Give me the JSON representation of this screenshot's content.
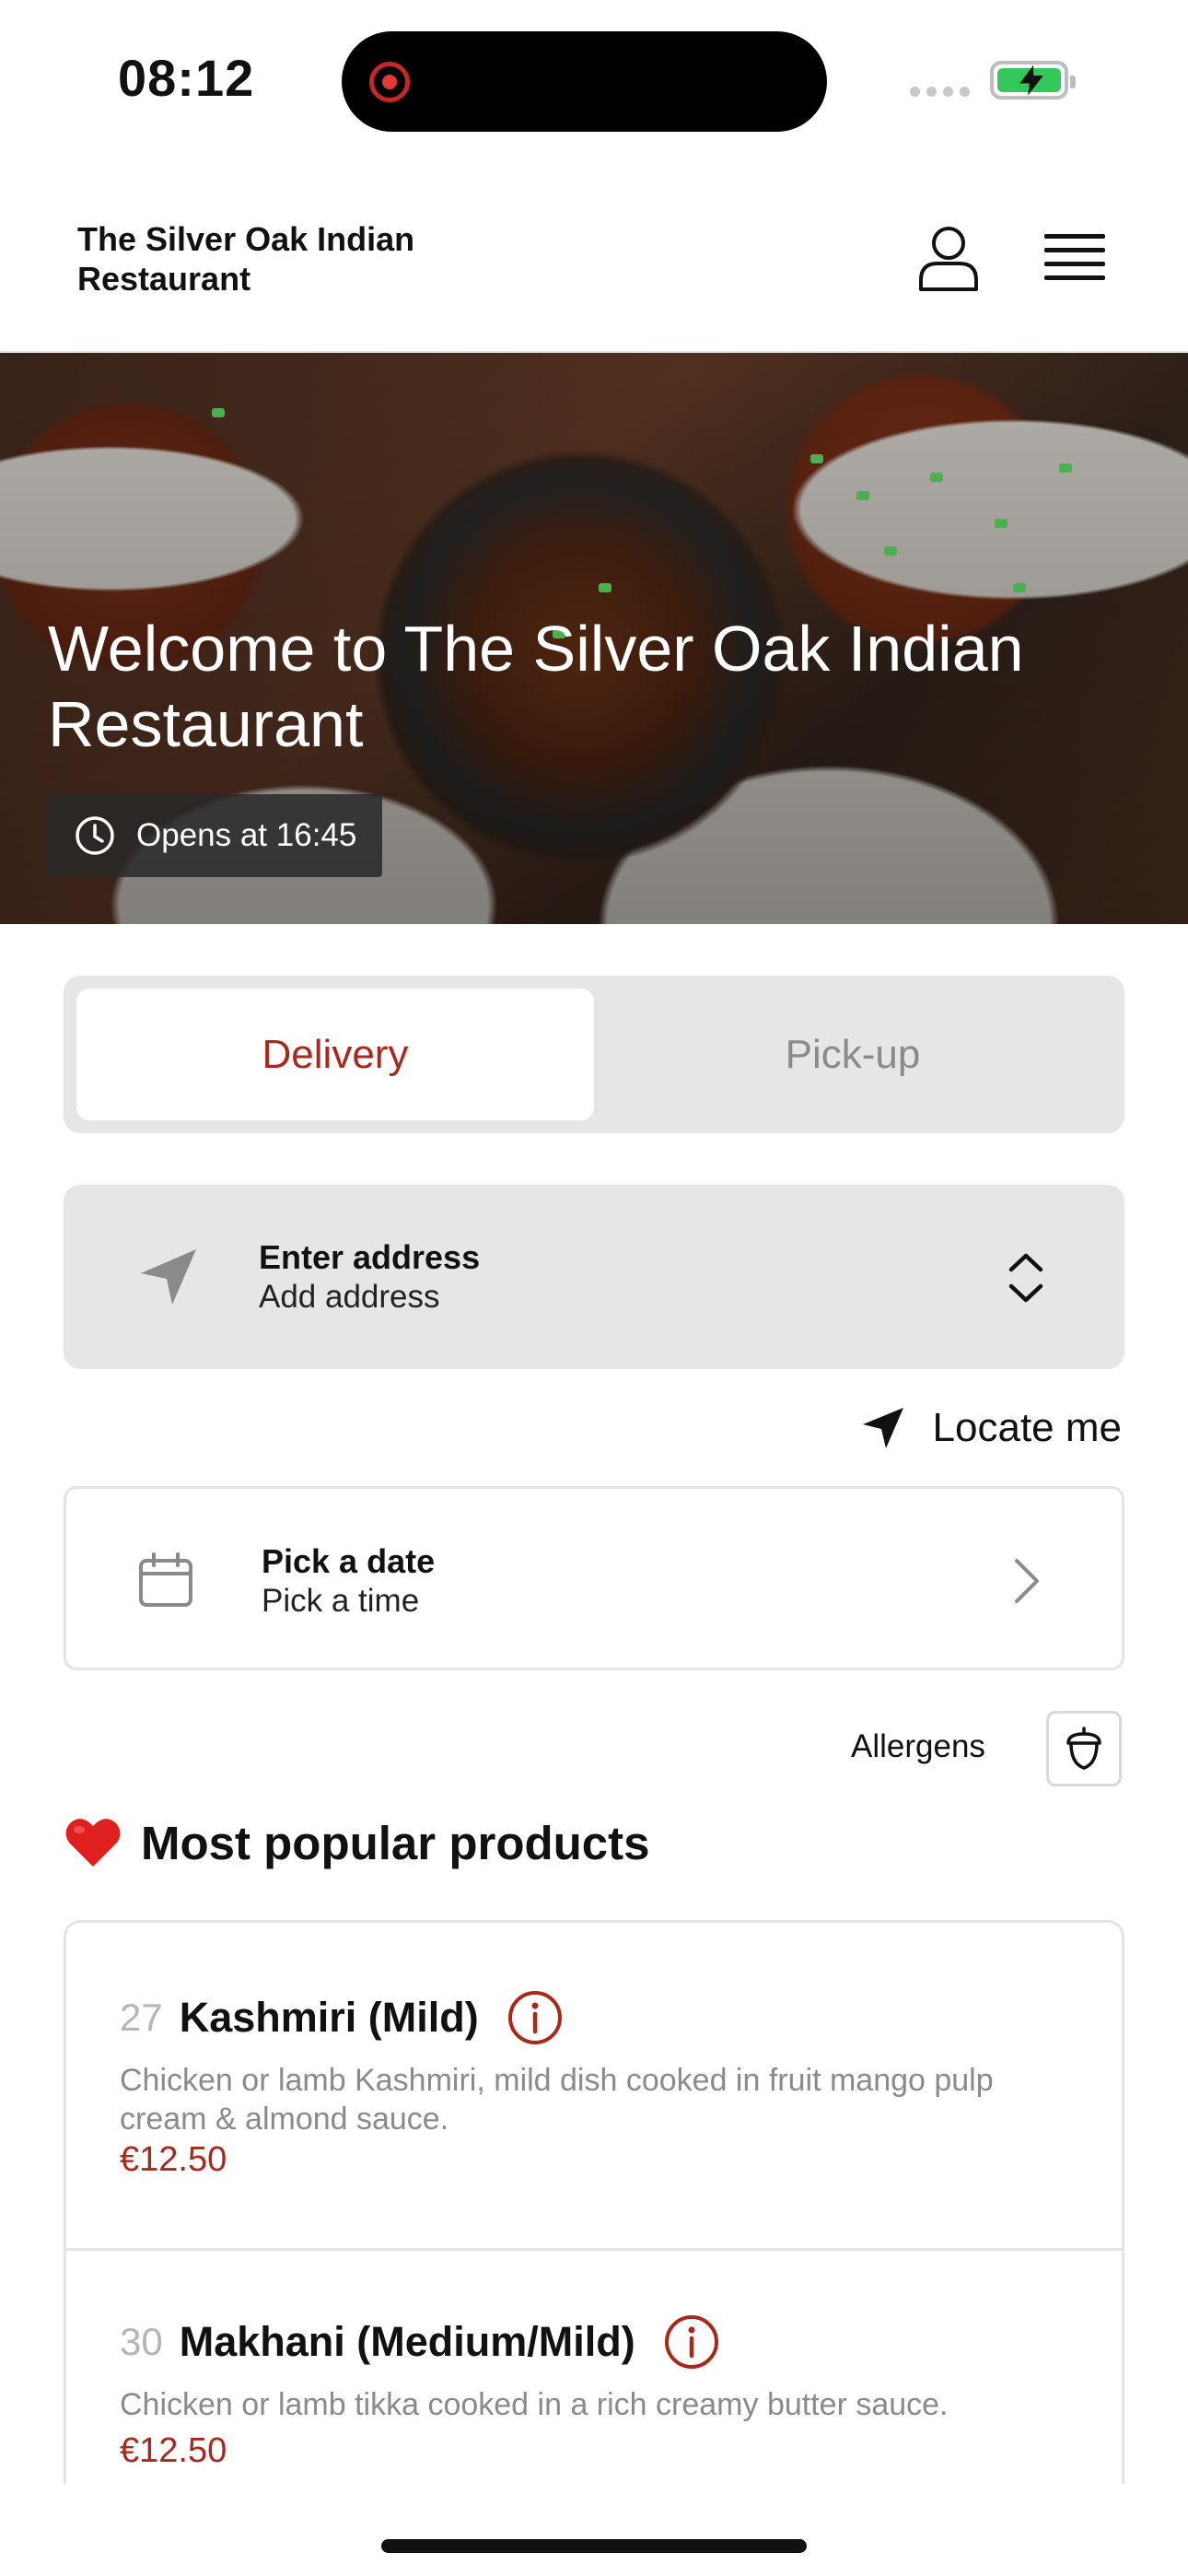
{
  "status_bar": {
    "time": "08:12"
  },
  "header": {
    "restaurant_name": "The Silver Oak Indian Restaurant"
  },
  "hero": {
    "title": "Welcome to The Silver Oak Indian Restaurant",
    "open_status": "Opens at 16:45"
  },
  "order_mode": {
    "options": [
      "Delivery",
      "Pick-up"
    ],
    "selected": "Delivery"
  },
  "address": {
    "title": "Enter address",
    "subtitle": "Add address"
  },
  "locate": {
    "label": "Locate me"
  },
  "schedule": {
    "title": "Pick a date",
    "subtitle": "Pick a time"
  },
  "allergens": {
    "label": "Allergens"
  },
  "popular": {
    "title": "Most popular products",
    "items": [
      {
        "number": "27",
        "name": "Kashmiri (Mild)",
        "description": "Chicken or lamb Kashmiri, mild dish cooked in fruit mango pulp cream & almond sauce.",
        "price": "€12.50"
      },
      {
        "number": "30",
        "name": "Makhani (Medium/Mild)",
        "description": "Chicken or lamb tikka cooked in a rich creamy butter sauce.",
        "price": "€12.50"
      }
    ]
  },
  "colors": {
    "accent": "#a8291b",
    "toggle_bg": "#e6e6e6",
    "battery": "#34c759"
  },
  "icons": [
    "record-icon",
    "signal-icon",
    "battery-icon",
    "user-icon",
    "menu-icon",
    "clock-icon",
    "navigation-arrow-icon",
    "chevron-up-down-icon",
    "calendar-icon",
    "chevron-right-icon",
    "acorn-icon",
    "heart-icon",
    "info-icon"
  ]
}
